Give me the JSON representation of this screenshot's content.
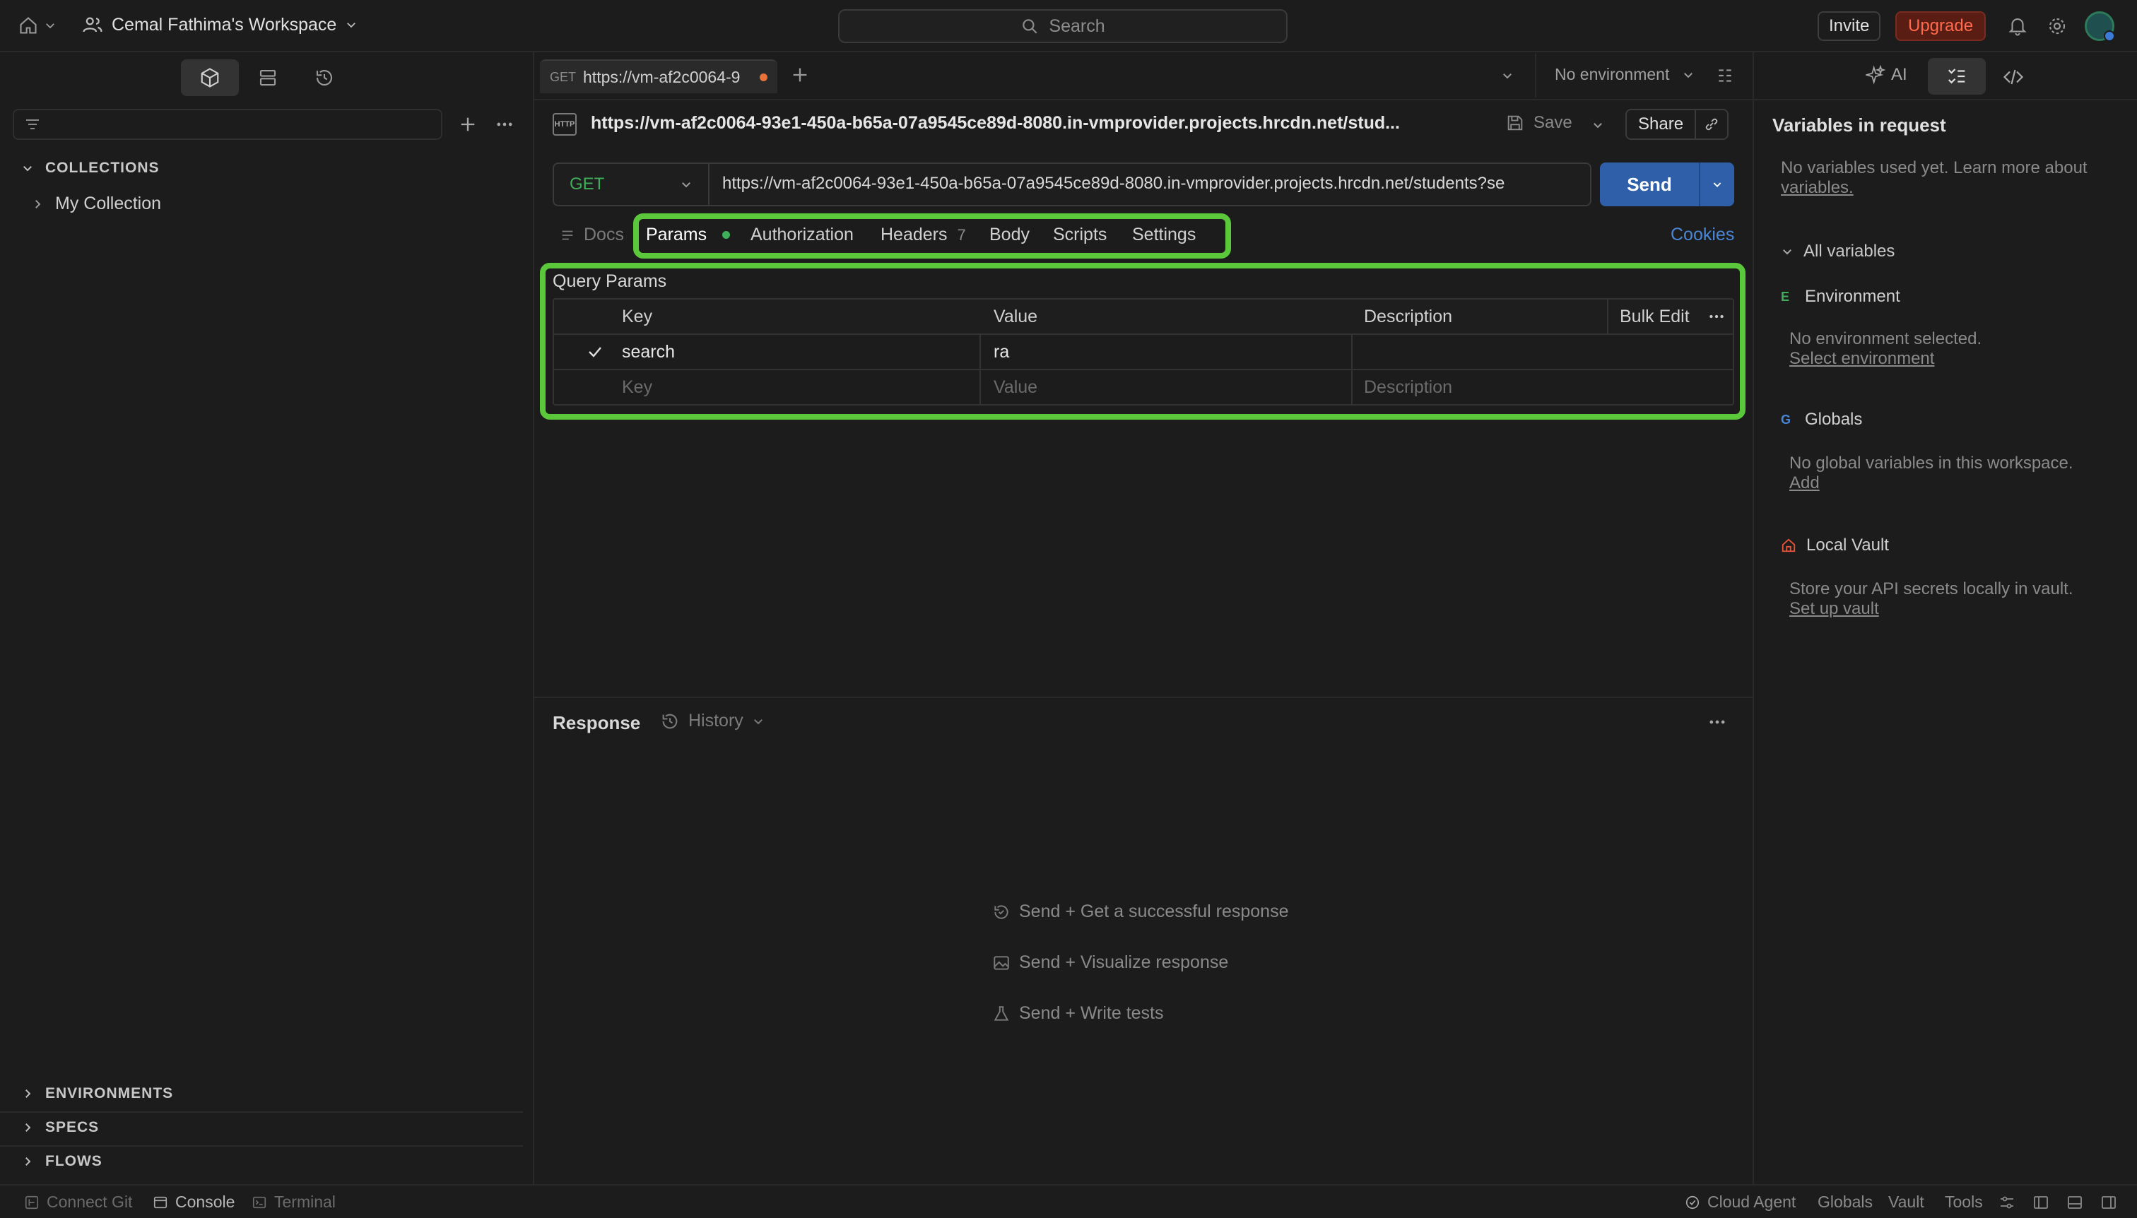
{
  "topbar": {
    "workspace": "Cemal Fathima's Workspace",
    "search_placeholder": "Search",
    "invite": "Invite",
    "upgrade": "Upgrade"
  },
  "sidebar": {
    "collections_header": "COLLECTIONS",
    "collection_item": "My Collection",
    "environments": "ENVIRONMENTS",
    "specs": "SPECS",
    "flows": "FLOWS"
  },
  "request_tab": {
    "method": "GET",
    "title": "https://vm-af2c0064-9"
  },
  "env_selector": "No environment",
  "request": {
    "badge": "HTTP",
    "name": "https://vm-af2c0064-93e1-450a-b65a-07a9545ce89d-8080.in-vmprovider.projects.hrcdn.net/stud...",
    "save": "Save",
    "share": "Share",
    "method": "GET",
    "url": "https://vm-af2c0064-93e1-450a-b65a-07a9545ce89d-8080.in-vmprovider.projects.hrcdn.net/students?se",
    "send": "Send"
  },
  "tabs": {
    "docs": "Docs",
    "params": "Params",
    "authorization": "Authorization",
    "headers": "Headers",
    "headers_count": "7",
    "body": "Body",
    "scripts": "Scripts",
    "settings": "Settings",
    "cookies": "Cookies"
  },
  "params": {
    "title": "Query Params",
    "headers": {
      "key": "Key",
      "value": "Value",
      "description": "Description",
      "bulk_edit": "Bulk Edit"
    },
    "rows": [
      {
        "key": "search",
        "value": "ra",
        "description": "",
        "checked": true
      }
    ],
    "placeholder": {
      "key": "Key",
      "value": "Value",
      "description": "Description"
    }
  },
  "response": {
    "title": "Response",
    "history": "History",
    "hints": [
      "Send + Get a successful response",
      "Send + Visualize response",
      "Send + Write tests"
    ]
  },
  "right_panel": {
    "tab_ai": "AI",
    "title": "Variables in request",
    "no_vars": "No variables used yet. Learn more about",
    "no_vars_link": "variables.",
    "all_variables": "All variables",
    "env_label": "Environment",
    "env_badge": "E",
    "env_desc": "No environment selected.",
    "env_link": "Select environment",
    "globals_label": "Globals",
    "globals_badge": "G",
    "globals_desc": "No global variables in this workspace.",
    "globals_link": "Add",
    "vault_label": "Local Vault",
    "vault_desc": "Store your API secrets locally in vault.",
    "vault_link": "Set up vault"
  },
  "footer": {
    "connect_git": "Connect Git",
    "console": "Console",
    "terminal": "Terminal",
    "cloud_agent": "Cloud Agent",
    "globals": "Globals",
    "vault": "Vault",
    "tools": "Tools"
  },
  "colors": {
    "highlight": "#5ac83a",
    "send": "#2e5fa8",
    "upgrade": "#ff6a4d",
    "dirty_dot": "#e8723a",
    "params_dot": "#3fae5a"
  }
}
